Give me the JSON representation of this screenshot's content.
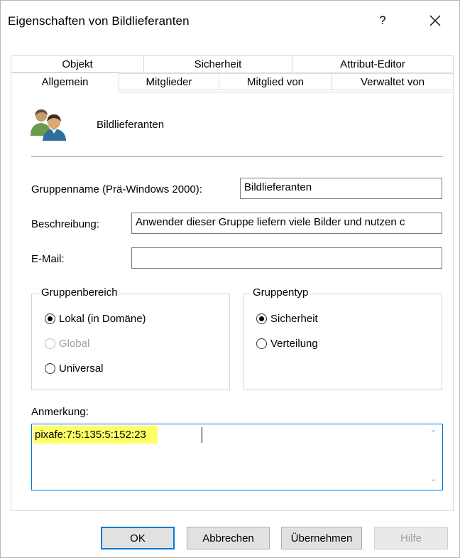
{
  "window": {
    "title": "Eigenschaften von Bildlieferanten",
    "help_label": "?"
  },
  "tabs_row1": [
    {
      "label": "Objekt"
    },
    {
      "label": "Sicherheit"
    },
    {
      "label": "Attribut-Editor"
    }
  ],
  "tabs_row2": [
    {
      "label": "Allgemein",
      "active": true
    },
    {
      "label": "Mitglieder"
    },
    {
      "label": "Mitglied von"
    },
    {
      "label": "Verwaltet von"
    }
  ],
  "header": {
    "group_name": "Bildlieferanten",
    "icon": "group-icon"
  },
  "fields": {
    "pre2000_label": "Gruppenname (Prä-Windows 2000):",
    "pre2000_value": "Bildlieferanten",
    "description_label": "Beschreibung:",
    "description_value": "Anwender dieser Gruppe liefern viele Bilder und nutzen c",
    "email_label": "E-Mail:",
    "email_value": ""
  },
  "scope_group": {
    "title": "Gruppenbereich",
    "options": [
      {
        "label": "Lokal (in Domäne)",
        "selected": true,
        "disabled": false
      },
      {
        "label": "Global",
        "selected": false,
        "disabled": true
      },
      {
        "label": "Universal",
        "selected": false,
        "disabled": false
      }
    ]
  },
  "type_group": {
    "title": "Gruppentyp",
    "options": [
      {
        "label": "Sicherheit",
        "selected": true
      },
      {
        "label": "Verteilung",
        "selected": false
      }
    ]
  },
  "notes": {
    "label": "Anmerkung:",
    "value": "pixafe:7:5:135:5:152:23",
    "highlight": "#ffff66"
  },
  "buttons": {
    "ok": "OK",
    "cancel": "Abbrechen",
    "apply": "Übernehmen",
    "help": "Hilfe"
  },
  "colors": {
    "focus": "#0078d7",
    "disabled_text": "#a0a0a0"
  }
}
